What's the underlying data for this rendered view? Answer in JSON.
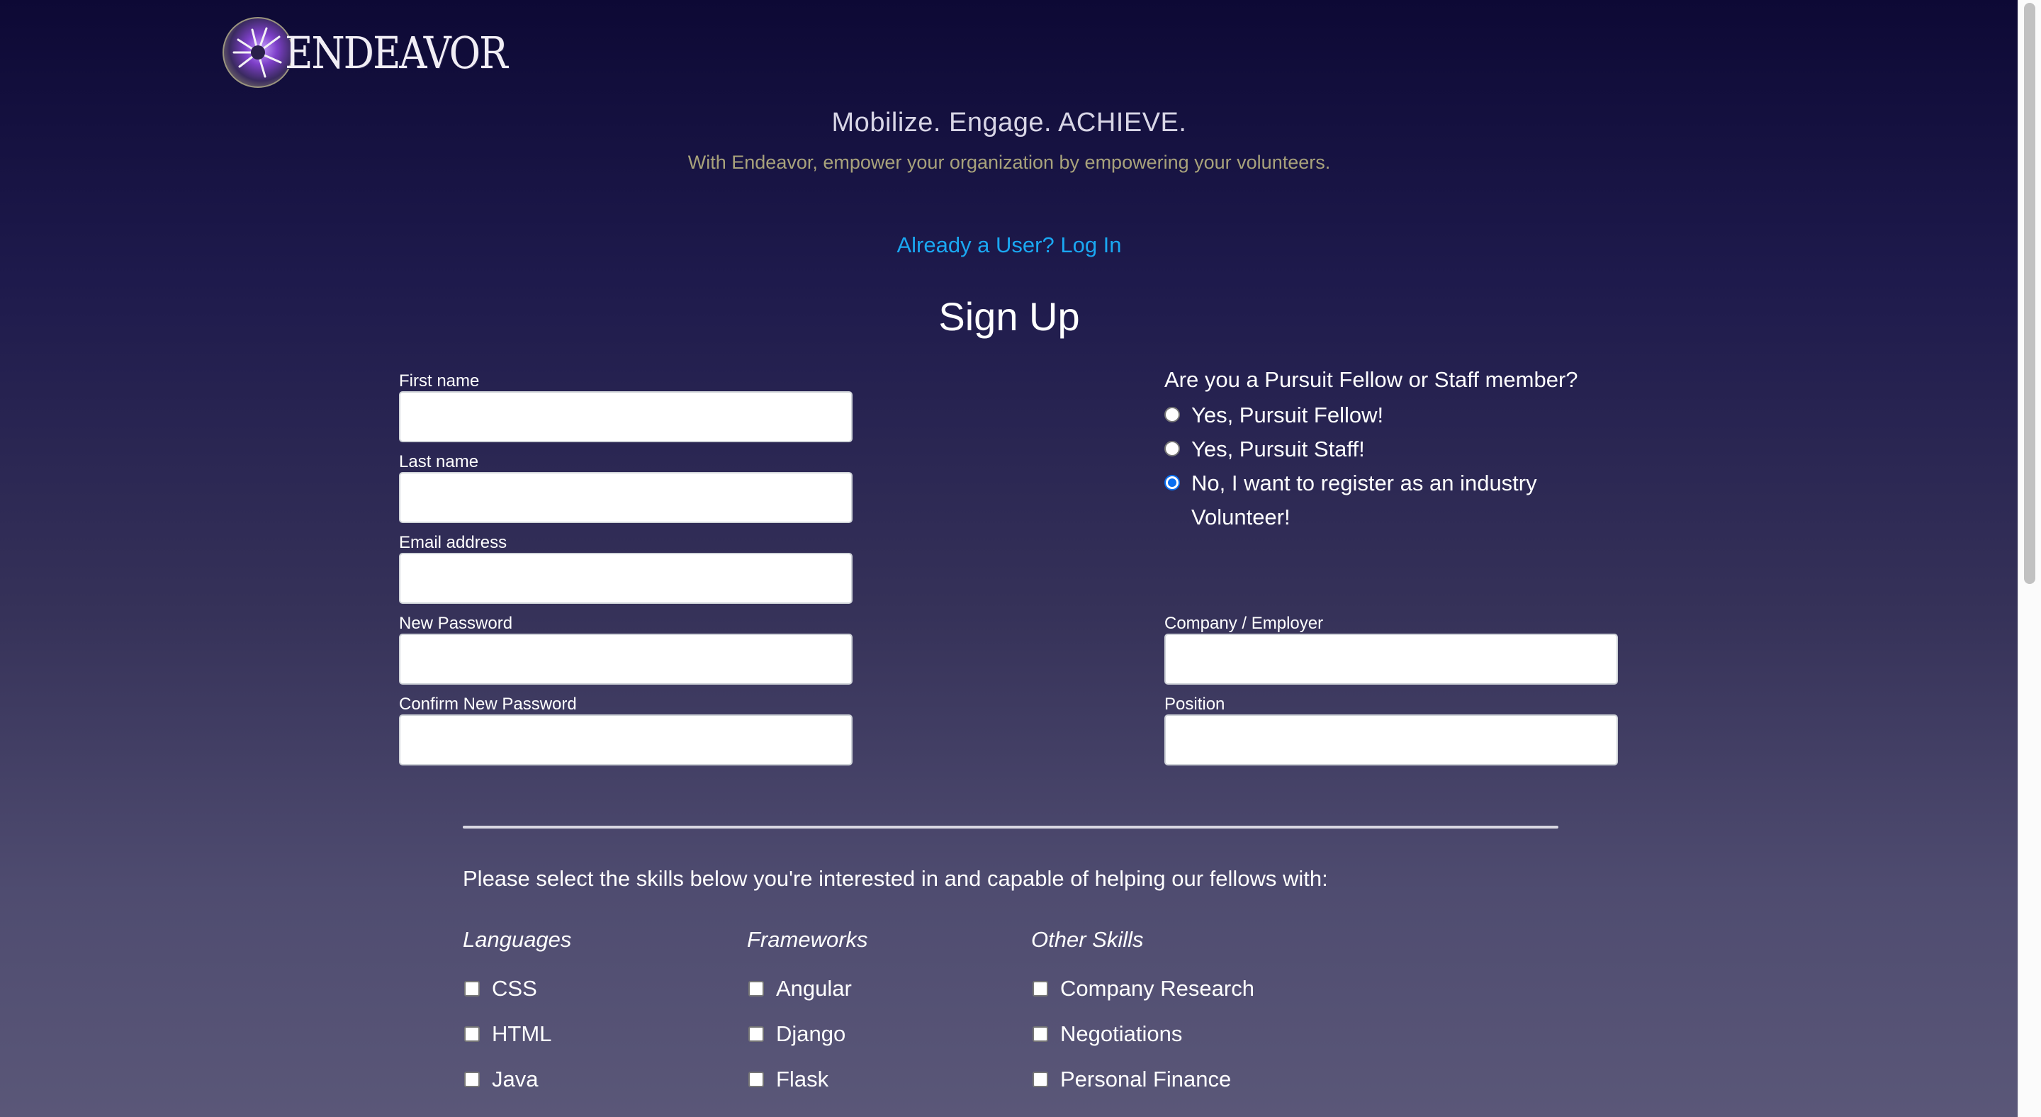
{
  "brand": {
    "logo_text": "ENDEAVOR",
    "tagline": "Mobilize. Engage. ACHIEVE.",
    "subtagline": "With Endeavor, empower your organization by empowering your volunteers."
  },
  "login_link": "Already a User? Log In",
  "page_title": "Sign Up",
  "form": {
    "first_name": {
      "label": "First name",
      "value": ""
    },
    "last_name": {
      "label": "Last name",
      "value": ""
    },
    "email": {
      "label": "Email address",
      "value": ""
    },
    "new_password": {
      "label": "New Password",
      "value": ""
    },
    "confirm_password": {
      "label": "Confirm New Password",
      "value": ""
    },
    "company": {
      "label": "Company / Employer",
      "value": ""
    },
    "position": {
      "label": "Position",
      "value": ""
    }
  },
  "role_question": {
    "label": "Are you a Pursuit Fellow or Staff member?",
    "options": [
      {
        "label": "Yes, Pursuit Fellow!",
        "checked": false
      },
      {
        "label": "Yes, Pursuit Staff!",
        "checked": false
      },
      {
        "label": "No, I want to register as an industry Volunteer!",
        "checked": true
      }
    ]
  },
  "skills": {
    "intro": "Please select the skills below you're interested in and capable of helping our fellows with:",
    "columns": [
      {
        "title": "Languages",
        "items": [
          "CSS",
          "HTML",
          "Java"
        ]
      },
      {
        "title": "Frameworks",
        "items": [
          "Angular",
          "Django",
          "Flask"
        ]
      },
      {
        "title": "Other Skills",
        "items": [
          "Company Research",
          "Negotiations",
          "Personal Finance"
        ]
      }
    ]
  },
  "colors": {
    "accent_link": "#1aa8f2",
    "radio_checked": "#0a6ff0",
    "subtagline": "#a8a27b"
  },
  "icons": {
    "logo": "endeavor-hands-logo-icon",
    "radio": "radio-button",
    "checkbox": "checkbox"
  }
}
